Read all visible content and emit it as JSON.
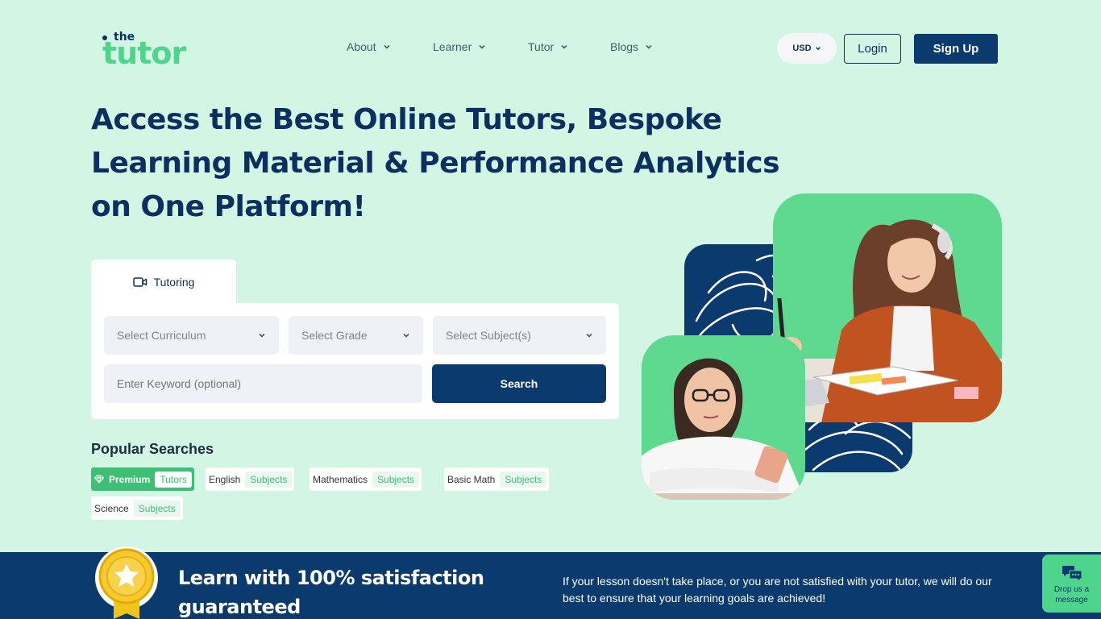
{
  "brand": {
    "logo_top": "the",
    "logo_main": "tutor"
  },
  "nav": {
    "items": [
      {
        "label": "About"
      },
      {
        "label": "Learner"
      },
      {
        "label": "Tutor"
      },
      {
        "label": "Blogs"
      }
    ]
  },
  "header": {
    "currency": "USD",
    "login": "Login",
    "signup": "Sign Up"
  },
  "hero": {
    "title": "Access the Best Online Tutors, Bespoke Learning Material & Performance Analytics on One Platform!"
  },
  "search": {
    "tab_label": "Tutoring",
    "curriculum_placeholder": "Select Curriculum",
    "grade_placeholder": "Select Grade",
    "subject_placeholder": "Select Subject(s)",
    "keyword_placeholder": "Enter Keyword (optional)",
    "button_label": "Search"
  },
  "popular": {
    "title": "Popular Searches",
    "chips": [
      {
        "label": "Premium",
        "tag": "Tutors"
      },
      {
        "label": "English",
        "tag": "Subjects"
      },
      {
        "label": "Mathematics",
        "tag": "Subjects"
      },
      {
        "label": "Basic Math",
        "tag": "Subjects"
      },
      {
        "label": "Science",
        "tag": "Subjects"
      }
    ]
  },
  "banner": {
    "title": "Learn with 100% satisfaction guaranteed",
    "text": "If your lesson doesn't take place, or you are not satisfied with your tutor, we will do our best to ensure that your learning goals are achieved!"
  },
  "chat": {
    "label": "Drop us a message"
  },
  "colors": {
    "navy": "#0b3a6e",
    "green": "#4fd48c",
    "background": "#d2f6e3"
  },
  "icons": [
    "chevron-down-icon",
    "video-camera-icon",
    "diamond-icon",
    "medal-icon",
    "chat-bubbles-icon"
  ]
}
